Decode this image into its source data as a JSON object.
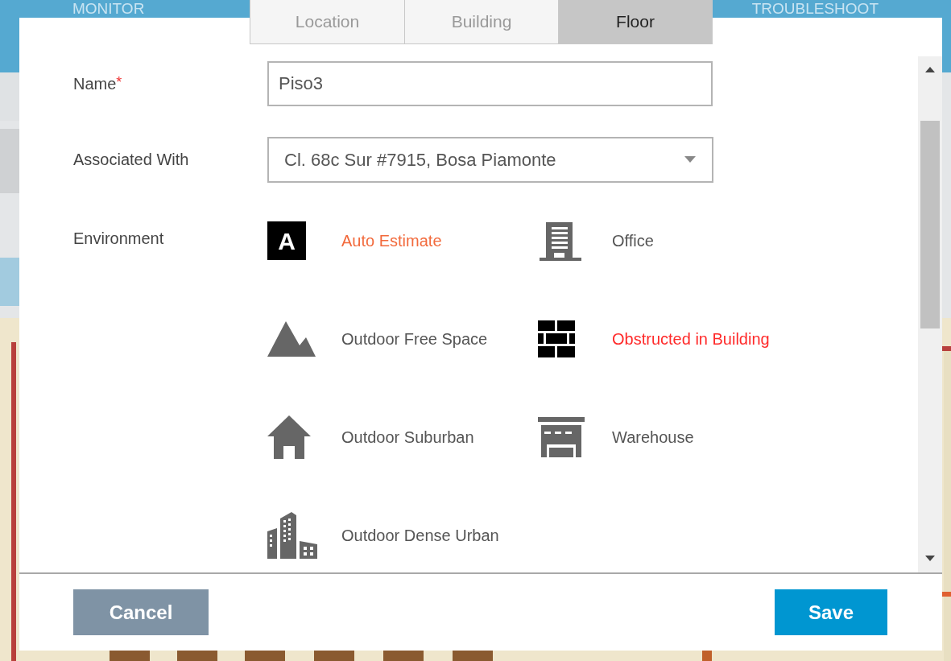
{
  "background": {
    "nav": [
      "MONITOR",
      "TROUBLESHOOT"
    ]
  },
  "tabs": [
    {
      "label": "Location",
      "selected": false
    },
    {
      "label": "Building",
      "selected": false
    },
    {
      "label": "Floor",
      "selected": true
    }
  ],
  "form": {
    "name": {
      "label": "Name",
      "required_mark": "*",
      "value": "Piso3"
    },
    "associated_with": {
      "label": "Associated With",
      "value": "Cl. 68c Sur #7915, Bosa Piamonte"
    },
    "environment": {
      "label": "Environment",
      "options": [
        {
          "kind": "auto",
          "badge": "A",
          "label": "Auto Estimate",
          "color": "#f26a3c"
        },
        {
          "kind": "office",
          "label": "Office",
          "color": "#555555"
        },
        {
          "kind": "mountain",
          "label": "Outdoor Free Space",
          "color": "#555555"
        },
        {
          "kind": "wall",
          "label": "Obstructed in Building",
          "color": "#ff2a2a"
        },
        {
          "kind": "house",
          "label": "Outdoor Suburban",
          "color": "#555555"
        },
        {
          "kind": "warehouse",
          "label": "Warehouse",
          "color": "#555555"
        },
        {
          "kind": "city",
          "label": "Outdoor Dense Urban",
          "color": "#555555"
        }
      ]
    }
  },
  "buttons": {
    "cancel": "Cancel",
    "save": "Save"
  }
}
